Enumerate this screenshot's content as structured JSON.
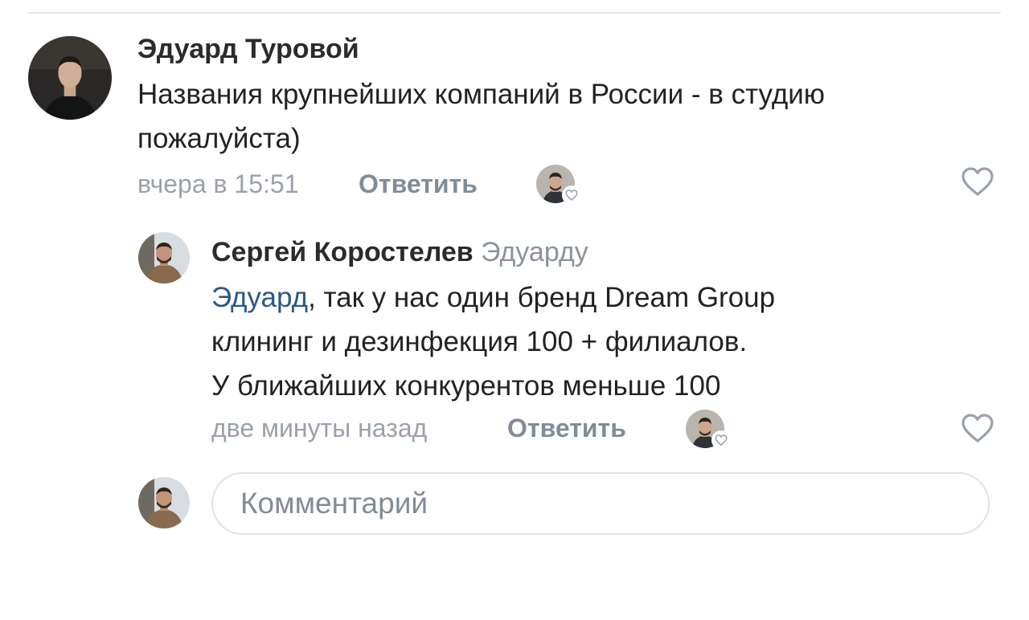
{
  "comment": {
    "author": "Эдуард Туровой",
    "text_lines": [
      "Названия крупнейших компаний в России - в студию",
      "пожалуйста)"
    ],
    "time": "вчера в 15:51",
    "reply_label": "Ответить"
  },
  "reply": {
    "author": "Сергей Коростелев",
    "addressee": "Эдуарду",
    "mention": "Эдуард",
    "text_first_rest": ", так у нас один бренд Dream Group",
    "text_lines": [
      "клининг и дезинфекция 100 + филиалов.",
      "У ближайших конкурентов меньше 100"
    ],
    "time": "две минуты назад",
    "reply_label": "Ответить"
  },
  "composer": {
    "placeholder": "Комментарий"
  },
  "icons": {
    "like": "heart-outline-icon",
    "liked_by_badge": "small-heart-icon"
  },
  "colors": {
    "mention": "#2a5885",
    "muted": "#818c99",
    "divider": "#e7e8ec"
  }
}
